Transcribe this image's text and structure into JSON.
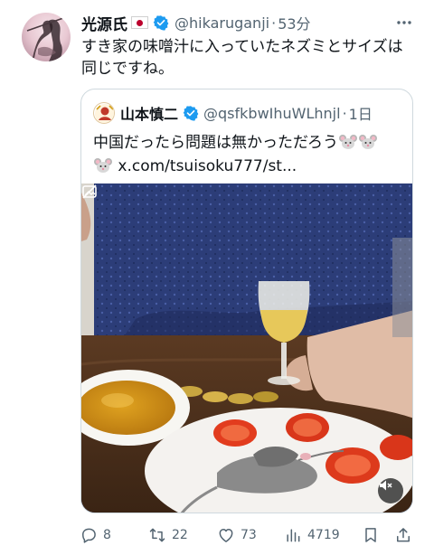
{
  "post": {
    "display_name": "光源氏",
    "handle": "@hikaruganji",
    "separator": "·",
    "time": "53分",
    "text_line1": "すき家の味噌汁に入っていたネズミとサイズは",
    "text_line2": "同じですね。"
  },
  "quote": {
    "display_name": "山本慎二",
    "handle": "@qsfkbwIhuWLhnjl",
    "separator": "·",
    "time": "1日",
    "text_line1": "中国だったら問題は無かっただろう",
    "text_line2": "x.com/tsuisoku777/st..."
  },
  "actions": {
    "replies": "8",
    "reposts": "22",
    "likes": "73",
    "views": "4719"
  },
  "colors": {
    "verified": "#1d9bf0",
    "secondary_text": "#536471",
    "border": "#cfd9de"
  },
  "icons": [
    "flag-japan-icon",
    "verified-badge-icon",
    "more-icon",
    "mouse-emoji-icon",
    "reply-icon",
    "repost-icon",
    "like-icon",
    "views-icon",
    "bookmark-icon",
    "share-icon",
    "mute-icon"
  ]
}
